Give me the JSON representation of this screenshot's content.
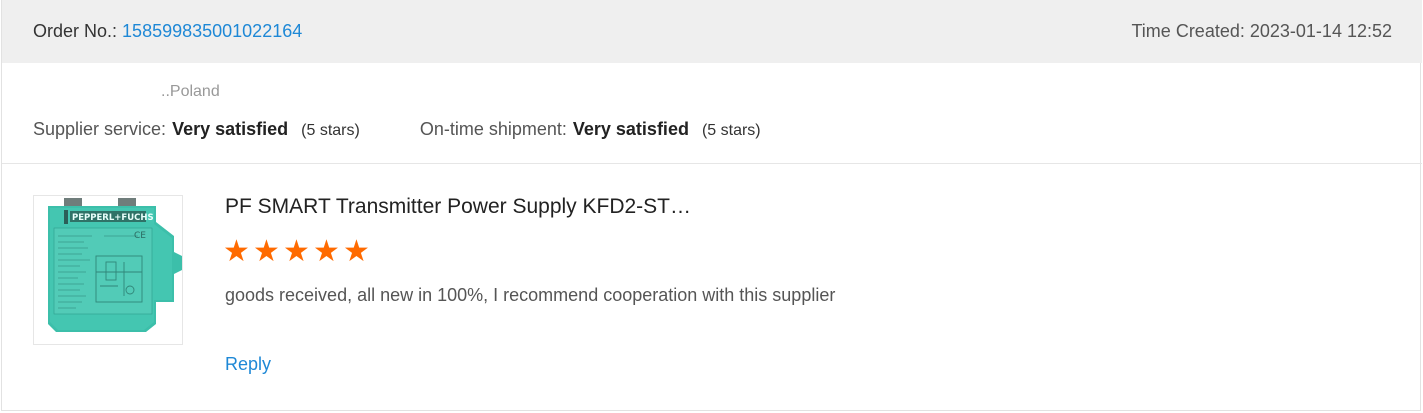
{
  "header": {
    "order_label": "Order No.:",
    "order_number": "158599835001022164",
    "time_label": "Time Created:",
    "time_value": "2023-01-14 12:52"
  },
  "buyer": {
    "country": "..Poland"
  },
  "ratings": {
    "supplier_service": {
      "label": "Supplier service:",
      "value": "Very satisfied",
      "stars_text": "(5 stars)"
    },
    "on_time_shipment": {
      "label": "On-time shipment:",
      "value": "Very satisfied",
      "stars_text": "(5 stars)"
    }
  },
  "review": {
    "product_title": "PF SMART Transmitter Power Supply KFD2-ST…",
    "star_rating": 5,
    "star_max": 5,
    "star_color": "#ff6a00",
    "comment": "goods received, all new in 100%, I recommend cooperation with this supplier",
    "reply_label": "Reply",
    "product_image": {
      "icon": "pepperl-fuchs-module-image",
      "brand_text": "PEPPERL+FUCHS",
      "body_color": "#3cbfaa"
    }
  },
  "colors": {
    "link": "#1e88d6",
    "header_bg": "#efefef"
  }
}
